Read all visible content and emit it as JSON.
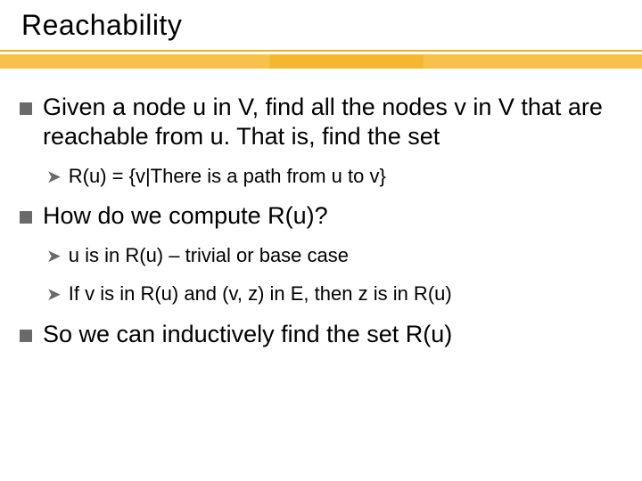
{
  "title": "Reachability",
  "bullets": {
    "b1": "Given a node u in V, find all the nodes v in V that are reachable from u. That is, find the set",
    "b1_sub1": "R(u) = {v|There is a path from u to v}",
    "b2": "How do we compute R(u)?",
    "b2_sub1": "u is in R(u) – trivial or base case",
    "b2_sub2": "If v is in R(u) and (v, z) in E, then z is in R(u)",
    "b3": "So we can inductively find the set R(u)"
  }
}
